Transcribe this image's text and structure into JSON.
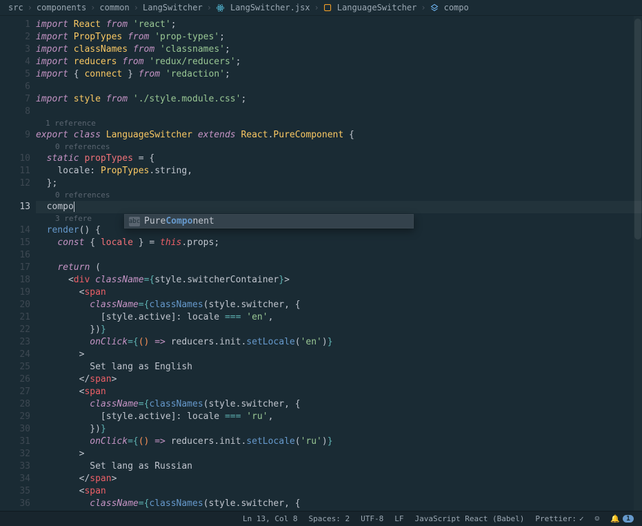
{
  "breadcrumbs": {
    "items": [
      "src",
      "components",
      "common",
      "LangSwitcher",
      "LangSwitcher.jsx",
      "LanguageSwitcher",
      "compo"
    ]
  },
  "codelens": {
    "ref1": "1 reference",
    "ref0a": "0 references",
    "ref0b": "0 references",
    "ref3": "3 refere"
  },
  "autocomplete": {
    "kind": "abc",
    "prefix": "Pure",
    "match": "Compo",
    "suffix": "nent"
  },
  "code": {
    "typed": "compo",
    "l1": {
      "kw1": "import",
      "cls": "React",
      "kw2": "from",
      "str": "'react'",
      "p": ";"
    },
    "l2": {
      "kw1": "import",
      "cls": "PropTypes",
      "kw2": "from",
      "str": "'prop-types'",
      "p": ";"
    },
    "l3": {
      "kw1": "import",
      "cls": "classNames",
      "kw2": "from",
      "str": "'classnames'",
      "p": ";"
    },
    "l4": {
      "kw1": "import",
      "cls": "reducers",
      "kw2": "from",
      "str": "'redux/reducers'",
      "p": ";"
    },
    "l5": {
      "kw1": "import",
      "b1": "{ ",
      "cls": "connect",
      "b2": " }",
      "kw2": "from",
      "str": "'redaction'",
      "p": ";"
    },
    "l7": {
      "kw1": "import",
      "cls": "style",
      "kw2": "from",
      "str": "'./style.module.css'",
      "p": ";"
    },
    "l9": {
      "kw1": "export",
      "kw2": "class",
      "cls": "LanguageSwitcher",
      "kw3": "extends",
      "ns": "React",
      "dot": ".",
      "typ": "PureComponent",
      "b": " {"
    },
    "l10": {
      "kw": "static",
      "var": "propTypes",
      "eq": " = {"
    },
    "l11": {
      "key": "locale",
      "col": ": ",
      "ns": "PropTypes",
      "dot": ".",
      "prop": "string",
      "c": ","
    },
    "l12": {
      "b": "};"
    },
    "l14": {
      "fn": "render",
      "par": "() {"
    },
    "l15": {
      "kw": "const",
      "b1": " { ",
      "var": "locale",
      "b2": " } = ",
      "this": "this",
      "dot": ".",
      "prop": "props",
      "p": ";"
    },
    "l17": {
      "kw": "return",
      "p": " ("
    },
    "l18": {
      "a1": "<",
      "tag": "div",
      "sp": " ",
      "attr": "className",
      "eq": "=",
      "b1": "{",
      "ns": "style",
      "dot": ".",
      "prop": "switcherContainer",
      "b2": "}",
      "a2": ">"
    },
    "l19": {
      "a1": "<",
      "tag": "span"
    },
    "l20": {
      "attr": "className",
      "eq": "=",
      "b1": "{",
      "fn": "classNames",
      "p1": "(",
      "ns": "style",
      "dot": ".",
      "prop": "switcher",
      "c": ", {"
    },
    "l21": {
      "b1": "[",
      "ns": "style",
      "dot": ".",
      "prop": "active",
      "b2": "]: ",
      "var": "locale",
      "op": " === ",
      "str": "'en'",
      "c": ","
    },
    "l22": {
      "b": "})",
      "b2": "}"
    },
    "l23": {
      "attr": "onClick",
      "eq": "=",
      "b1": "{",
      "p1": "()",
      "arrow": " => ",
      "ns": "reducers",
      "d1": ".",
      "ns2": "init",
      "d2": ".",
      "fn": "setLocale",
      "p2": "(",
      "str": "'en'",
      "p3": ")",
      "b2": "}"
    },
    "l24": {
      "a": ">"
    },
    "l25": {
      "txt": "Set lang as English"
    },
    "l26": {
      "a1": "</",
      "tag": "span",
      "a2": ">"
    },
    "l27": {
      "a1": "<",
      "tag": "span"
    },
    "l28": {
      "attr": "className",
      "eq": "=",
      "b1": "{",
      "fn": "classNames",
      "p1": "(",
      "ns": "style",
      "dot": ".",
      "prop": "switcher",
      "c": ", {"
    },
    "l29": {
      "b1": "[",
      "ns": "style",
      "dot": ".",
      "prop": "active",
      "b2": "]: ",
      "var": "locale",
      "op": " === ",
      "str": "'ru'",
      "c": ","
    },
    "l30": {
      "b": "})",
      "b2": "}"
    },
    "l31": {
      "attr": "onClick",
      "eq": "=",
      "b1": "{",
      "p1": "()",
      "arrow": " => ",
      "ns": "reducers",
      "d1": ".",
      "ns2": "init",
      "d2": ".",
      "fn": "setLocale",
      "p2": "(",
      "str": "'ru'",
      "p3": ")",
      "b2": "}"
    },
    "l32": {
      "a": ">"
    },
    "l33": {
      "txt": "Set lang as Russian"
    },
    "l34": {
      "a1": "</",
      "tag": "span",
      "a2": ">"
    },
    "l35": {
      "a1": "<",
      "tag": "span"
    },
    "l36": {
      "attr": "className",
      "eq": "=",
      "b1": "{",
      "fn": "classNames",
      "p1": "(",
      "ns": "style",
      "dot": ".",
      "prop": "switcher",
      "c": ", {"
    }
  },
  "statusbar": {
    "pos": "Ln 13, Col 8",
    "spaces": "Spaces: 2",
    "encoding": "UTF-8",
    "eol": "LF",
    "lang": "JavaScript React (Babel)",
    "prettier": "Prettier: ",
    "check": "✓",
    "smile": "☺",
    "bell_count": "1"
  }
}
